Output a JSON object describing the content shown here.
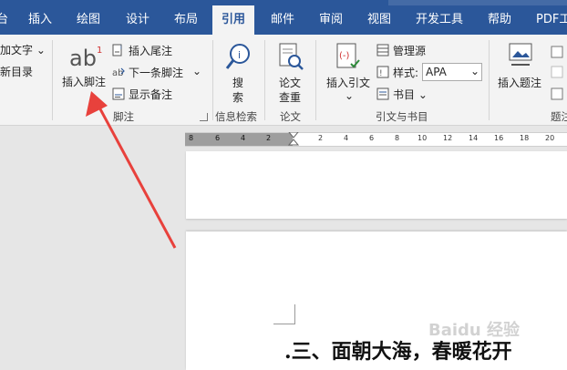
{
  "tabs": [
    "台",
    "插入",
    "绘图",
    "设计",
    "布局",
    "引用",
    "邮件",
    "审阅",
    "视图",
    "开发工具",
    "帮助",
    "PDF工"
  ],
  "active_tab": "引用",
  "ribbon": {
    "toc_group": {
      "add_text": "加文字 ⌄",
      "update_toc": "新目录"
    },
    "footnotes": {
      "insert_footnote": "插入脚注",
      "insert_endnote": "插入尾注",
      "next_footnote": "下一条脚注",
      "next_footnote_caret": "⌄",
      "show_notes": "显示备注",
      "group_label": "脚注"
    },
    "research": {
      "search_line1": "搜",
      "search_line2": "索",
      "group_label": "信息检索"
    },
    "paper": {
      "line1": "论文",
      "line2": "查重",
      "group_label": "论文"
    },
    "citations": {
      "insert_citation": "插入引文",
      "insert_citation_caret": "⌄",
      "manage_sources": "管理源",
      "style_label": "样式:",
      "style_value": "APA",
      "bibliography": "书目 ⌄",
      "group_label": "引文与书目"
    },
    "captions": {
      "insert_caption": "插入题注",
      "group_label": "题注"
    }
  },
  "ruler": {
    "ticks": [
      "8",
      "6",
      "4",
      "2",
      "2",
      "4",
      "6",
      "8",
      "10",
      "12",
      "14",
      "16",
      "18",
      "20"
    ]
  },
  "document": {
    "heading": ".三、面朝大海，春暖花开"
  },
  "watermark": "Baidu 经验",
  "colors": {
    "accent": "#2b579a",
    "arrow": "#e8413c",
    "ribbon": "#f3f3f3"
  }
}
